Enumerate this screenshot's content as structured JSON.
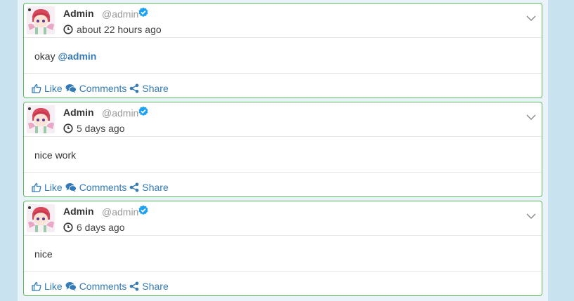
{
  "posts": [
    {
      "author_name": "Admin",
      "author_handle": "@admin",
      "time": "about 22 hours ago",
      "text": "okay ",
      "mention": "@admin"
    },
    {
      "author_name": "Admin",
      "author_handle": "@admin",
      "time": "5 days ago",
      "text": "nice work",
      "mention": ""
    },
    {
      "author_name": "Admin",
      "author_handle": "@admin",
      "time": "6 days ago",
      "text": "nice",
      "mention": ""
    }
  ],
  "actions": {
    "like": "Like",
    "comments": "Comments",
    "share": "Share"
  },
  "colors": {
    "accent": "#337ab7",
    "border": "#5cb85c",
    "verified": "#1da1f2"
  },
  "icons": [
    "verified-badge-icon",
    "clock-icon",
    "chevron-down-icon",
    "thumbs-up-icon",
    "comments-icon",
    "share-icon"
  ]
}
